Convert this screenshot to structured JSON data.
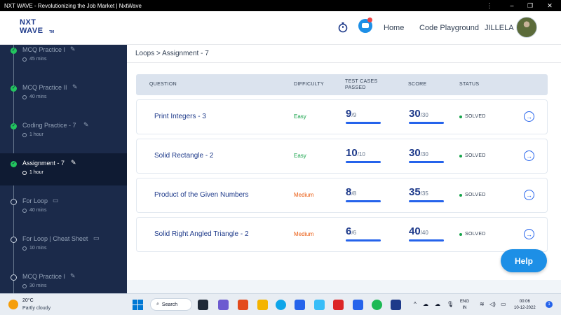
{
  "window": {
    "title": "NXT WAVE - Revolutionizing the Job Market | NxtWave"
  },
  "header": {
    "logo_line1": "NXT",
    "logo_line2": "WAVE",
    "logo_tm": "TM",
    "nav": [
      "Home",
      "Code Playground"
    ],
    "username": "JILLELA",
    "icons": [
      "stopwatch-icon",
      "chat-icon"
    ],
    "accent": "#1e3a8a"
  },
  "sidebar": {
    "items": [
      {
        "title": "MCQ Practice I",
        "meta": "45 mins",
        "status": "done",
        "kind": "edit"
      },
      {
        "title": "MCQ Practice II",
        "meta": "40 mins",
        "status": "done",
        "kind": "edit"
      },
      {
        "title": "Coding Practice - 7",
        "meta": "1 hour",
        "status": "done",
        "kind": "edit"
      },
      {
        "title": "Assignment - 7",
        "meta": "1 hour",
        "status": "done",
        "kind": "edit",
        "active": true
      },
      {
        "title": "For Loop",
        "meta": "40 mins",
        "status": "todo",
        "kind": "book"
      },
      {
        "title": "For Loop | Cheat Sheet",
        "meta": "10 mins",
        "status": "todo",
        "kind": "book"
      },
      {
        "title": "MCQ Practice I",
        "meta": "30 mins",
        "status": "todo",
        "kind": "edit"
      }
    ]
  },
  "breadcrumb": "Loops > Assignment - 7",
  "table": {
    "headers": [
      "QUESTION",
      "DIFFICULTY",
      "TEST CASES PASSED",
      "SCORE",
      "STATUS"
    ],
    "rows": [
      {
        "question": "Print Integers - 3",
        "difficulty": "Easy",
        "tc": "9",
        "tc_total": "/9",
        "score": "30",
        "score_total": "/30",
        "status": "SOLVED"
      },
      {
        "question": "Solid Rectangle - 2",
        "difficulty": "Easy",
        "tc": "10",
        "tc_total": "/10",
        "score": "30",
        "score_total": "/30",
        "status": "SOLVED"
      },
      {
        "question": "Product of the Given Numbers",
        "difficulty": "Medium",
        "tc": "8",
        "tc_total": "/8",
        "score": "35",
        "score_total": "/35",
        "status": "SOLVED"
      },
      {
        "question": "Solid Right Angled Triangle - 2",
        "difficulty": "Medium",
        "tc": "6",
        "tc_total": "/6",
        "score": "40",
        "score_total": "/40",
        "status": "SOLVED"
      }
    ]
  },
  "help_label": "Help",
  "taskbar": {
    "temperature": "20°C",
    "weather": "Partly cloudy",
    "search_label": "Search",
    "lang_line1": "ENG",
    "lang_line2": "IN",
    "time": "00:06",
    "date": "10-12-2022",
    "notifications": "1"
  }
}
